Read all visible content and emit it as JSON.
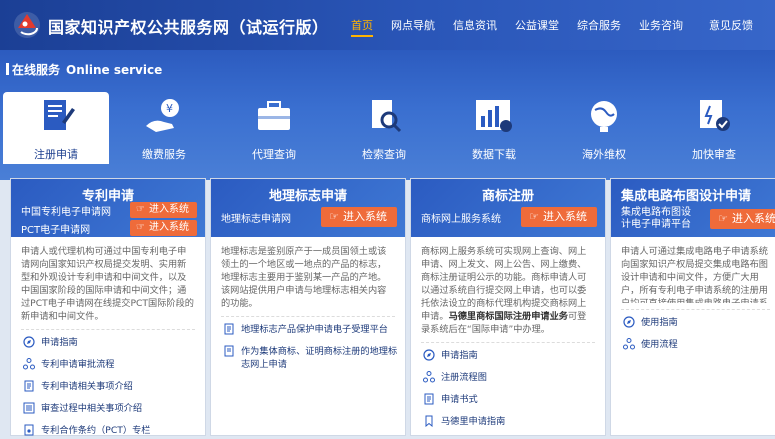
{
  "header": {
    "title": "国家知识产权公共服务网（试运行版）",
    "nav": [
      "首页",
      "网点导航",
      "信息资讯",
      "公益课堂",
      "综合服务",
      "业务咨询",
      "意见反馈"
    ]
  },
  "section": {
    "cn": "在线服务",
    "en": "Online service"
  },
  "services": [
    {
      "label": "注册申请",
      "icon": "document-pen-icon"
    },
    {
      "label": "缴费服务",
      "icon": "payment-hand-icon"
    },
    {
      "label": "代理查询",
      "icon": "briefcase-icon"
    },
    {
      "label": "检索查询",
      "icon": "magnifier-doc-icon"
    },
    {
      "label": "数据下载",
      "icon": "bar-chart-icon"
    },
    {
      "label": "海外维权",
      "icon": "globe-icon"
    },
    {
      "label": "加快审查",
      "icon": "fast-check-icon"
    }
  ],
  "cards": {
    "patent": {
      "title": "专利申请",
      "row1": "中国专利电子申请网",
      "row2": "PCT电子申请网",
      "button": "进入系统",
      "desc": "申请人或代理机构可通过中国专利电子申请网向国家知识产权局提交发明、实用新型和外观设计专利申请和中间文件，以及中国国家阶段的国际申请和中间文件；通过PCT电子申请网在线提交PCT国际阶段的新申请和中间文件。",
      "links": [
        "申请指南",
        "专利申请审批流程",
        "专利申请相关事项介绍",
        "审查过程中相关事项介绍",
        "专利合作条约（PCT）专栏"
      ]
    },
    "gi": {
      "title": "地理标志申请",
      "row1": "地理标志申请网",
      "button": "进入系统",
      "desc": "地理标志是鉴别原产于一成员国领土或该领土的一个地区或一地点的产品的标志，地理标志主要用于鉴别某一产品的产地。该网站提供用户申请与地理标志相关内容的功能。",
      "links": [
        "地理标志产品保护申请电子受理平台",
        "作为集体商标、证明商标注册的地理标志网上申请"
      ]
    },
    "tm": {
      "title": "商标注册",
      "row1": "商标网上服务系统",
      "button": "进入系统",
      "desc_a": "商标网上服务系统可实现网上查询、网上申请、网上发文、网上公告、网上缴费、商标注册证明公示的功能。商标申请人可以通过系统自行提交网上申请，也可以委托依法设立的商标代理机构提交商标网上申请。",
      "desc_b": "马德里商标国际注册申请业务",
      "desc_c": "可登录系统后在“国际申请”中办理。",
      "links": [
        "申请指南",
        "注册流程图",
        "申请书式",
        "马德里申请指南"
      ]
    },
    "ic": {
      "title": "集成电路布图设计申请",
      "row1": "集成电路布图设计电子申请平台",
      "button": "进入系统",
      "desc": "申请人可通过集成电路电子申请系统向国家知识产权局提交集成电路布图设计申请和中间文件，方便广大用户，所有专利电子申请系统的注册用户均可直接使用集成电路电子申请系统，无需另外注册用户需办理注册手续。",
      "links": [
        "使用指南",
        "使用流程"
      ]
    }
  },
  "colors": {
    "accent": "#ef6b3a",
    "nav_active": "#ffb300",
    "primary": "#2b5bc1"
  }
}
